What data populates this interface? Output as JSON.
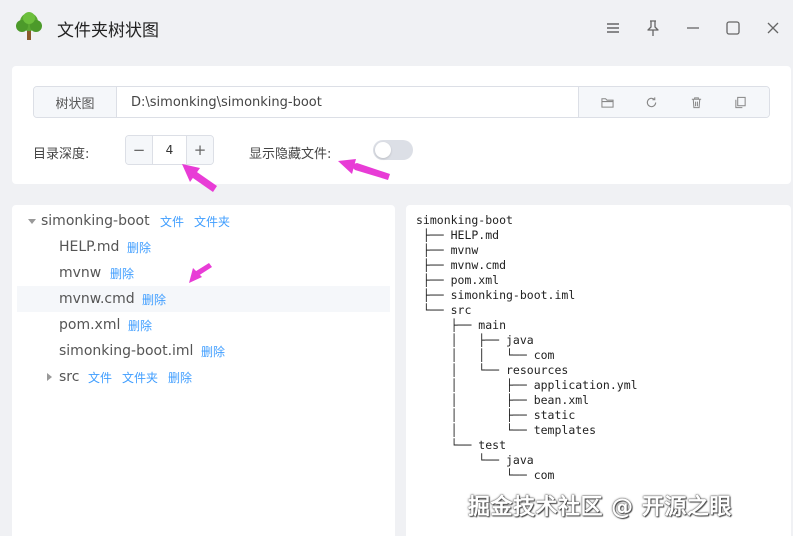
{
  "window": {
    "title": "文件夹树状图"
  },
  "path_bar": {
    "prefix_label": "树状图",
    "value": "D:\\simonking\\simonking-boot"
  },
  "options": {
    "depth_label": "目录深度:",
    "depth_value": "4",
    "show_hidden_label": "显示隐藏文件:",
    "show_hidden_on": false
  },
  "tree": {
    "root": {
      "name": "simonking-boot",
      "actions": [
        "文件",
        "文件夹"
      ]
    },
    "children": [
      {
        "name": "HELP.md",
        "actions": [
          "删除"
        ]
      },
      {
        "name": "mvnw",
        "actions": [
          "删除"
        ]
      },
      {
        "name": "mvnw.cmd",
        "actions": [
          "删除"
        ]
      },
      {
        "name": "pom.xml",
        "actions": [
          "删除"
        ]
      },
      {
        "name": "simonking-boot.iml",
        "actions": [
          "删除"
        ]
      },
      {
        "name": "src",
        "actions": [
          "文件",
          "文件夹",
          "删除"
        ]
      }
    ]
  },
  "output": {
    "text": "simonking-boot\n ├── HELP.md\n ├── mvnw\n ├── mvnw.cmd\n ├── pom.xml\n ├── simonking-boot.iml\n └── src\n     ├── main\n     │   ├── java\n     │   │   └── com\n     │   └── resources\n     │       ├── application.yml\n     │       ├── bean.xml\n     │       ├── static\n     │       └── templates\n     └── test\n         └── java\n             └── com"
  },
  "watermark": "掘金技术社区 @ 开源之眼",
  "colors": {
    "link": "#409eff",
    "annotation_arrow": "#e83cd6"
  }
}
